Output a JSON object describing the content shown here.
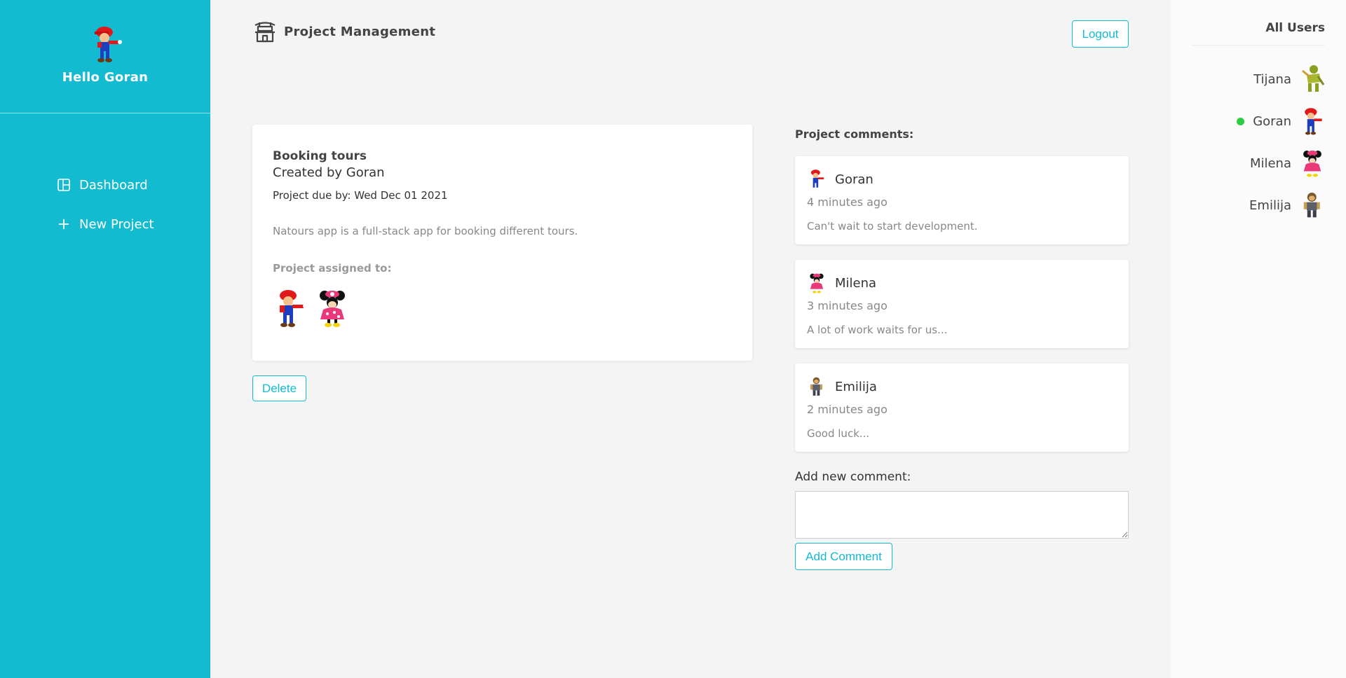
{
  "sidebar": {
    "greeting": "Hello Goran",
    "nav": [
      {
        "label": "Dashboard",
        "icon": "dashboard-icon"
      },
      {
        "label": "New Project",
        "icon": "plus-icon"
      }
    ]
  },
  "header": {
    "title": "Project Management",
    "logout_label": "Logout"
  },
  "project": {
    "title": "Booking tours",
    "created_by": "Created by Goran",
    "due": "Project due by: Wed Dec 01 2021",
    "description": "Natours app is a full-stack app for booking different tours.",
    "assigned_label": "Project assigned to:",
    "assigned": [
      "Goran",
      "Milena"
    ],
    "delete_label": "Delete"
  },
  "comments": {
    "label": "Project comments:",
    "items": [
      {
        "author": "Goran",
        "time": "4 minutes ago",
        "text": "Can't wait to start development."
      },
      {
        "author": "Milena",
        "time": "3 minutes ago",
        "text": "A lot of work waits for us..."
      },
      {
        "author": "Emilija",
        "time": "2 minutes ago",
        "text": "Good luck..."
      }
    ],
    "add_label": "Add new comment:",
    "input_value": "",
    "add_button": "Add Comment"
  },
  "users": {
    "title": "All Users",
    "list": [
      {
        "name": "Tijana",
        "online": false
      },
      {
        "name": "Goran",
        "online": true
      },
      {
        "name": "Milena",
        "online": false
      },
      {
        "name": "Emilija",
        "online": false
      }
    ]
  },
  "colors": {
    "accent": "#12bbd0",
    "online": "#2ecc40"
  }
}
